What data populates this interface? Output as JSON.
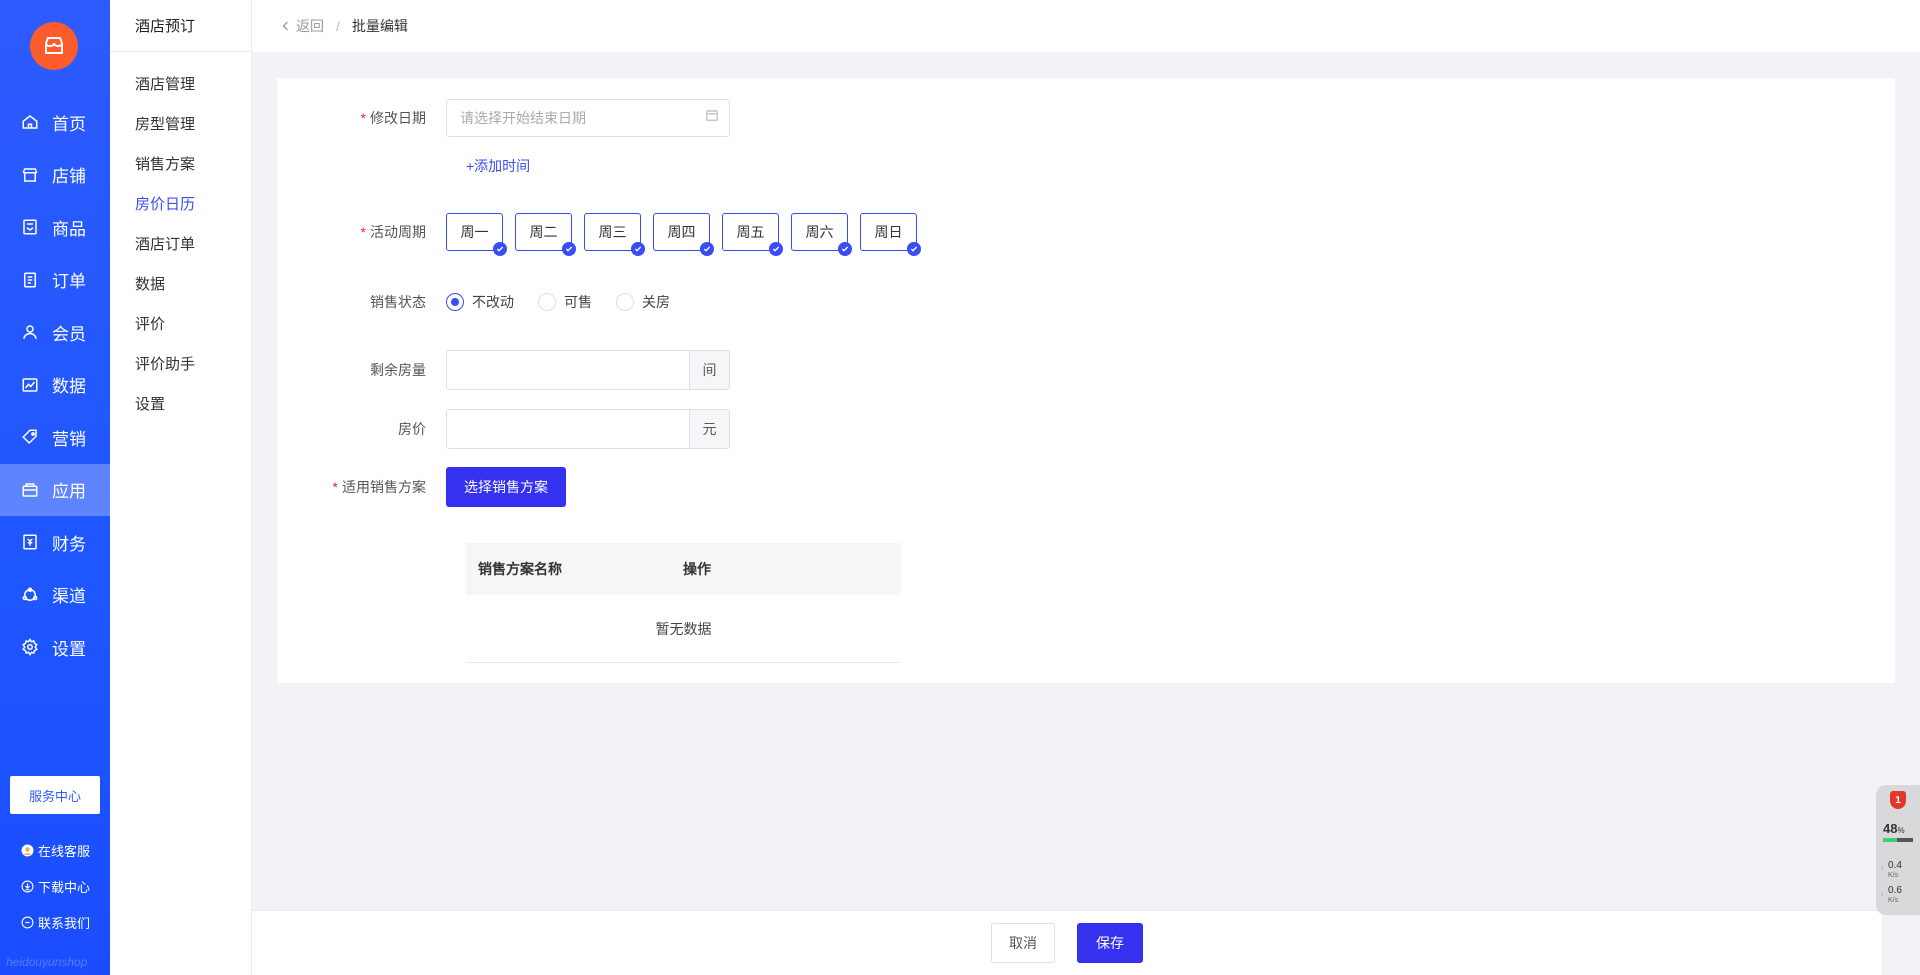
{
  "sidebar": {
    "items": [
      {
        "label": "首页",
        "icon": "home-icon"
      },
      {
        "label": "店铺",
        "icon": "store-icon"
      },
      {
        "label": "商品",
        "icon": "goods-icon"
      },
      {
        "label": "订单",
        "icon": "order-icon"
      },
      {
        "label": "会员",
        "icon": "member-icon"
      },
      {
        "label": "数据",
        "icon": "chart-icon"
      },
      {
        "label": "营销",
        "icon": "tag-icon"
      },
      {
        "label": "应用",
        "icon": "app-icon"
      },
      {
        "label": "财务",
        "icon": "finance-icon"
      },
      {
        "label": "渠道",
        "icon": "channel-icon"
      },
      {
        "label": "设置",
        "icon": "gear-icon"
      }
    ],
    "active": "应用",
    "service_center": "服务中心",
    "links": [
      {
        "label": "在线客服",
        "icon": "support-avatar-icon"
      },
      {
        "label": "下载中心",
        "icon": "download-icon"
      },
      {
        "label": "联系我们",
        "icon": "chat-icon"
      }
    ],
    "watermark": "heidouyunshop"
  },
  "subnav": {
    "title": "酒店预订",
    "items": [
      "酒店管理",
      "房型管理",
      "销售方案",
      "房价日历",
      "酒店订单",
      "数据",
      "评价",
      "评价助手",
      "设置"
    ],
    "active": "房价日历"
  },
  "breadcrumb": {
    "back": "返回",
    "separator": "/",
    "current": "批量编辑"
  },
  "form": {
    "date": {
      "label": "修改日期",
      "placeholder": "请选择开始结束日期",
      "add_time": "+添加时间"
    },
    "cycle": {
      "label": "活动周期",
      "days": [
        "周一",
        "周二",
        "周三",
        "周四",
        "周五",
        "周六",
        "周日"
      ]
    },
    "status": {
      "label": "销售状态",
      "options": [
        "不改动",
        "可售",
        "关房"
      ],
      "selected": "不改动"
    },
    "rooms": {
      "label": "剩余房量",
      "suffix": "间",
      "value": ""
    },
    "price": {
      "label": "房价",
      "suffix": "元",
      "value": ""
    },
    "plan": {
      "label": "适用销售方案",
      "button": "选择销售方案",
      "table": {
        "columns": [
          "销售方案名称",
          "操作"
        ],
        "empty": "暂无数据"
      }
    }
  },
  "footer": {
    "cancel": "取消",
    "save": "保存"
  },
  "monitor": {
    "badge": "1",
    "percent": "48",
    "percent_unit": "%",
    "percent_value": 48,
    "up": "0.4",
    "down": "0.6",
    "unit": "K/s"
  },
  "colors": {
    "primary": "#3432ef",
    "sidebar": "#1e56ff",
    "logo": "#ff5c2e",
    "required": "#f5222d"
  }
}
